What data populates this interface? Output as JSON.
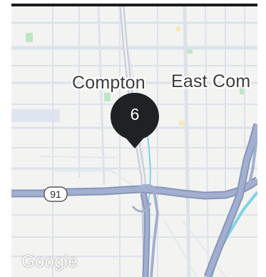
{
  "map": {
    "labels": {
      "compton": "Compton",
      "east_compton": "East Com"
    },
    "cluster": {
      "count": "6",
      "color": "#202124"
    },
    "route_shield": {
      "number": "91"
    },
    "attribution": {
      "logo_text": "Google"
    },
    "colors": {
      "background": "#f3f3f1",
      "freeway": "#9aa8c8",
      "road": "#dde2ea",
      "water": "#7fd3e6",
      "park": "#bfe6c4"
    }
  }
}
